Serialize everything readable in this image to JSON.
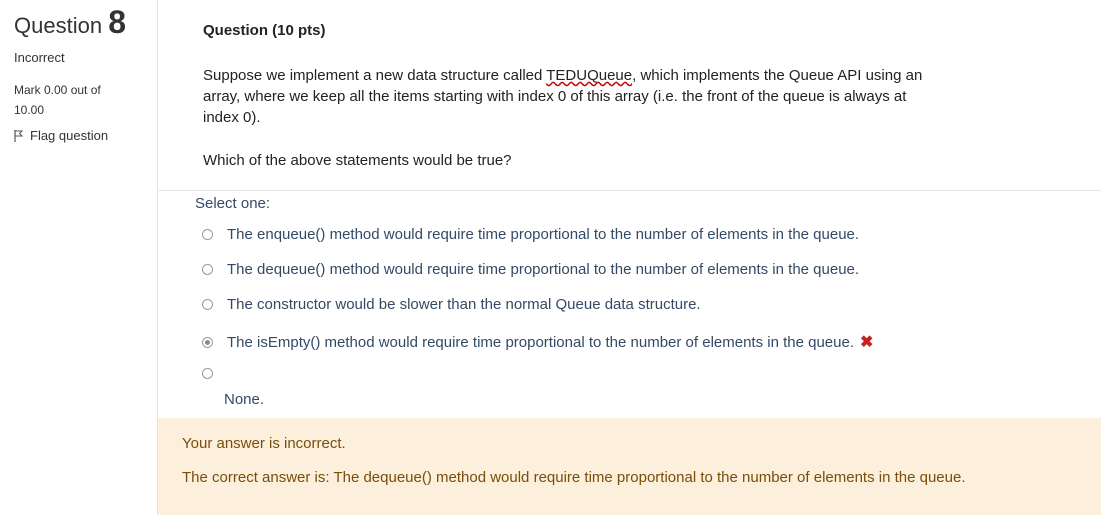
{
  "info": {
    "question_word": "Question",
    "question_number": "8",
    "state": "Incorrect",
    "grade_line1": "Mark 0.00 out of",
    "grade_line2": "10.00",
    "flag_label": "Flag question"
  },
  "question": {
    "header": "Question (10 pts)",
    "body_part1": "Suppose we implement a new data structure called ",
    "body_spell": "TEDUQueue",
    "body_part2": ", which implements the Queue API using an array, where we keep all the items starting with index 0 of this array (i.e. the front of the queue is always at index 0).",
    "question_text": "Which of the above statements would be true?",
    "prompt": "Select one:",
    "options": [
      {
        "label": "The enqueue() method would require time proportional to the number of elements in the queue.",
        "selected": false
      },
      {
        "label": "The dequeue() method would require time proportional to the number of elements in the queue.",
        "selected": false
      },
      {
        "label": "The constructor would be slower than the normal Queue data structure.",
        "selected": false
      },
      {
        "label": "The isEmpty() method would require time proportional to the number of elements in the queue.",
        "selected": true,
        "mark": "✖"
      },
      {
        "label": "None.",
        "selected": false
      }
    ]
  },
  "feedback": {
    "result": "Your answer is incorrect.",
    "correct_answer": "The correct answer is: The dequeue() method would require time proportional to the number of elements in the queue."
  },
  "colors": {
    "feedback_bg": "#fcefdc",
    "feedback_text": "#7a4d0b",
    "answer_text": "#334a66",
    "incorrect_mark": "#cc1f1f"
  }
}
